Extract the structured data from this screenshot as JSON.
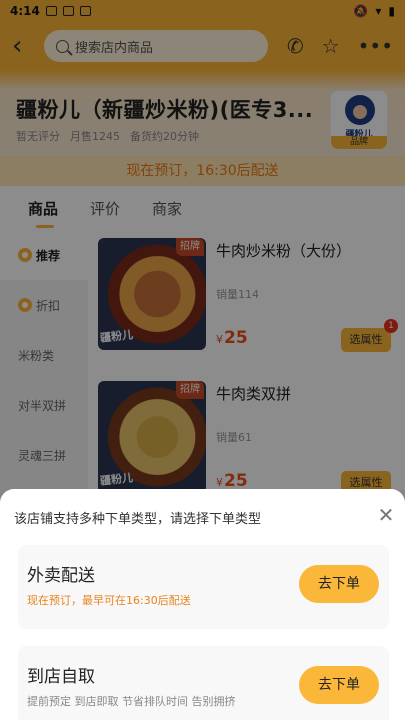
{
  "status_bar": {
    "time": "4:14"
  },
  "top_bar": {
    "search_placeholder": "搜索店内商品"
  },
  "shop": {
    "name": "疆粉儿（新疆炒米粉)(医专3...",
    "rating": "暂无评分",
    "monthly_sales": "月售1245",
    "prep_time": "备货约20分钟",
    "logo_text": "疆粉儿",
    "logo_brand": "品牌"
  },
  "preorder_banner": "现在预订，16:30后配送",
  "tabs": [
    "商品",
    "评价",
    "商家"
  ],
  "categories": [
    "推荐",
    "折扣",
    "米粉类",
    "对半双拼",
    "灵魂三拼"
  ],
  "products": [
    {
      "badge": "招牌",
      "name": "牛肉炒米粉（大份）",
      "sales": "销量114",
      "currency": "¥",
      "price": "25",
      "spec_label": "选属性",
      "spec_count": "1"
    },
    {
      "badge": "招牌",
      "name": "牛肉类双拼",
      "sales": "销量61",
      "currency": "¥",
      "price": "25",
      "spec_label": "选属性"
    }
  ],
  "sheet": {
    "title": "该店铺支持多种下单类型，请选择下单类型",
    "options": [
      {
        "title": "外卖配送",
        "desc": "现在预订，最早可在16:30后配送",
        "button": "去下单"
      },
      {
        "title": "到店自取",
        "desc": "提前预定 到店即取 节省排队时间 告别拥挤",
        "button": "去下单"
      }
    ]
  },
  "colors": {
    "accent": "#fbb73a",
    "price": "#e8531b",
    "notice": "#ee7a13"
  }
}
